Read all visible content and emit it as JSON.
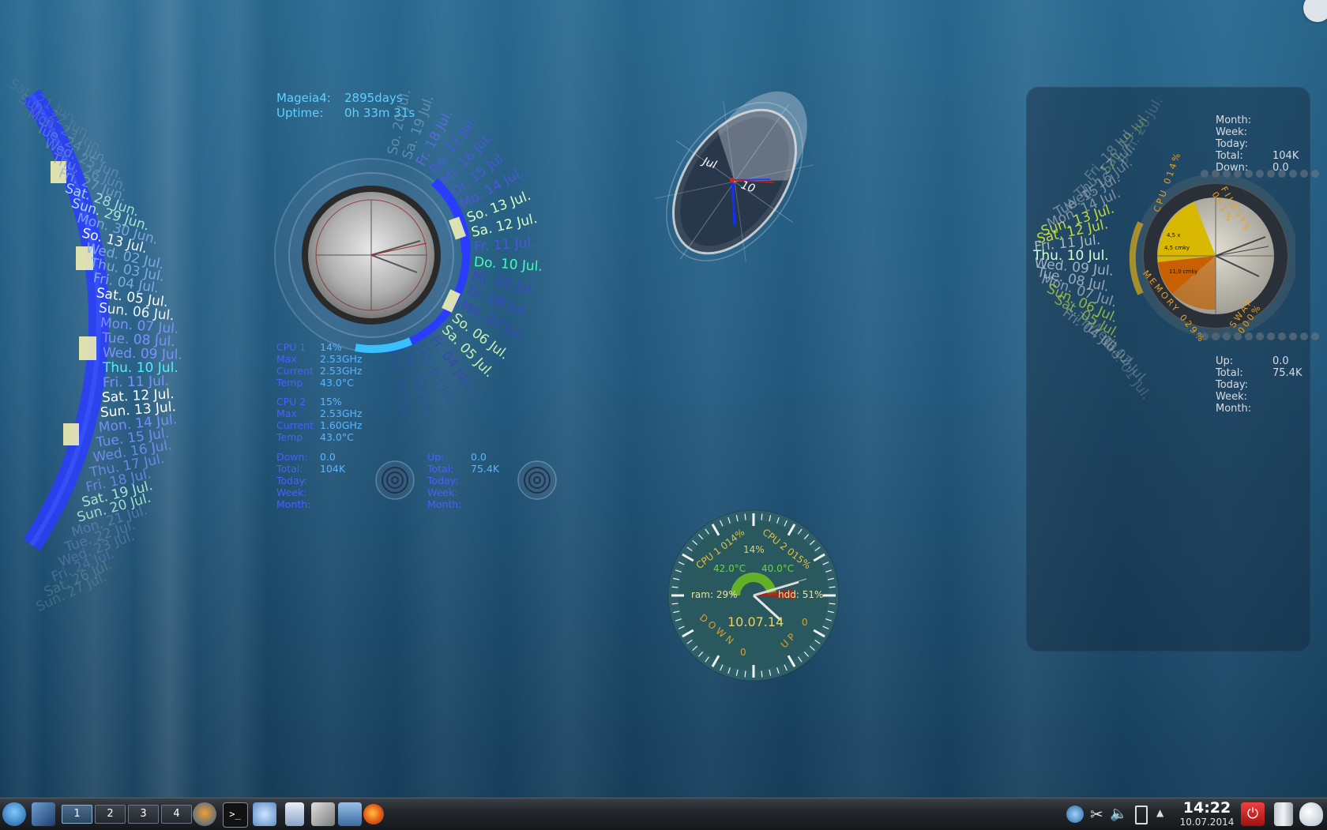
{
  "left_calendar": {
    "days": [
      {
        "label": "Sat. 21 Jun.",
        "color": "#6b86a8",
        "opacity": 0.35
      },
      {
        "label": "Sun. 22 Jun.",
        "color": "#6b86a8",
        "opacity": 0.45
      },
      {
        "label": "Mon. 23 Jun.",
        "color": "#6b86a8",
        "opacity": 0.5
      },
      {
        "label": "Tue. 24 Jun.",
        "color": "#7a98bd",
        "opacity": 0.55
      },
      {
        "label": "Wed. 25 Jun.",
        "color": "#7a98bd",
        "opacity": 0.6
      },
      {
        "label": "Thu. 26 Jun.",
        "color": "#7a98bd",
        "opacity": 0.65
      },
      {
        "label": "Fri. 27 Jun.",
        "color": "#8aa8d0",
        "opacity": 0.7
      },
      {
        "label": "Sat. 28 Jun.",
        "color": "#b8f0e0",
        "opacity": 0.85
      },
      {
        "label": "Sun. 29 Jun.",
        "color": "#b8f0e0",
        "opacity": 0.9
      },
      {
        "label": "Mon. 30 Jun.",
        "color": "#8ab0e8",
        "opacity": 0.85
      },
      {
        "label": "So. 13 Jul.",
        "color": "#ffffff",
        "opacity": 0.95
      },
      {
        "label": "Wed. 02 Jul.",
        "color": "#8ab0f0",
        "opacity": 0.9
      },
      {
        "label": "Thu. 03 Jul.",
        "color": "#8ab0f0",
        "opacity": 0.9
      },
      {
        "label": "Fri. 04 Jul.",
        "color": "#8ab0f0",
        "opacity": 0.9
      },
      {
        "label": "Sat. 05 Jul.",
        "color": "#ffffff",
        "opacity": 1
      },
      {
        "label": "Sun. 06 Jul.",
        "color": "#e8f4ff",
        "opacity": 1
      },
      {
        "label": "Mon. 07 Jul.",
        "color": "#7d90ff",
        "opacity": 1
      },
      {
        "label": "Tue. 08 Jul.",
        "color": "#7d90ff",
        "opacity": 1
      },
      {
        "label": "Wed. 09 Jul.",
        "color": "#7d90ff",
        "opacity": 1
      },
      {
        "label": "Thu. 10 Jul.",
        "color": "#4cf0ff",
        "opacity": 1
      },
      {
        "label": "Fri. 11 Jul.",
        "color": "#7d90ff",
        "opacity": 1
      },
      {
        "label": "Sat. 12 Jul.",
        "color": "#ffffff",
        "opacity": 1
      },
      {
        "label": "Sun. 13 Jul.",
        "color": "#ffffff",
        "opacity": 1
      },
      {
        "label": "Mon. 14 Jul.",
        "color": "#7d90ff",
        "opacity": 0.95
      },
      {
        "label": "Tue. 15 Jul.",
        "color": "#7d90ff",
        "opacity": 0.9
      },
      {
        "label": "Wed. 16 Jul.",
        "color": "#7d90ff",
        "opacity": 0.85
      },
      {
        "label": "Thu. 17 Jul.",
        "color": "#7d90ff",
        "opacity": 0.8
      },
      {
        "label": "Fri. 18 Jul.",
        "color": "#7d90ff",
        "opacity": 0.75
      },
      {
        "label": "Sat. 19 Jul.",
        "color": "#b8f0d8",
        "opacity": 0.9
      },
      {
        "label": "Sun. 20 Jul.",
        "color": "#b8f0d8",
        "opacity": 0.85
      },
      {
        "label": "Mon. 21 Jul.",
        "color": "#7088c8",
        "opacity": 0.6
      },
      {
        "label": "Tue. 22 Jul.",
        "color": "#7088c8",
        "opacity": 0.55
      },
      {
        "label": "Wed. 23 Jul.",
        "color": "#7088c8",
        "opacity": 0.5
      },
      {
        "label": "Fri. 24 Jul.",
        "color": "#7088c8",
        "opacity": 0.45
      },
      {
        "label": "Sat. 26 Jul.",
        "color": "#7aa0a0",
        "opacity": 0.4
      },
      {
        "label": "Sun. 27 Jul.",
        "color": "#7aa0a0",
        "opacity": 0.35
      }
    ]
  },
  "sysinfo": {
    "distro_label": "Mageia4:",
    "distro_value": "2895days",
    "uptime_label": "Uptime:",
    "uptime_value": "0h 33m 31s"
  },
  "cpu1": {
    "name": "CPU 1",
    "load": "14%",
    "max_label": "Max",
    "max": "2.53GHz",
    "current_label": "Current",
    "current": "2.53GHz",
    "temp_label": "Temp",
    "temp": "43.0°C"
  },
  "cpu2": {
    "name": "CPU 2",
    "load": "15%",
    "max_label": "Max",
    "max": "2.53GHz",
    "current_label": "Current",
    "current": "1.60GHz",
    "temp_label": "Temp",
    "temp": "43.0°C"
  },
  "net_down": {
    "down_label": "Down:",
    "down": "0.0",
    "total_label": "Total:",
    "total": "104K",
    "today_label": "Today:",
    "week_label": "Week:",
    "month_label": "Month:"
  },
  "net_up": {
    "up_label": "Up:",
    "up": "0.0",
    "total_label": "Total:",
    "total": "75.4K",
    "today_label": "Today:",
    "week_label": "Week:",
    "month_label": "Month:"
  },
  "dial_calendar": {
    "days": [
      {
        "label": "So. 20 Jul.",
        "color": "#8ab0c0"
      },
      {
        "label": "Sa. 19 Jul.",
        "color": "#8ab0c0"
      },
      {
        "label": "Fr. 18 Jul.",
        "color": "#5b6ad8"
      },
      {
        "label": "Do. 17 Jul.",
        "color": "#4a58d8"
      },
      {
        "label": "Mi. 16 Jul.",
        "color": "#4a58d8"
      },
      {
        "label": "Di. 15 Jul.",
        "color": "#4a58d8"
      },
      {
        "label": "Mo. 14 Jul.",
        "color": "#4a58d8"
      },
      {
        "label": "So. 13 Jul.",
        "color": "#d8ffc0"
      },
      {
        "label": "Sa. 12 Jul.",
        "color": "#d8ffc0"
      },
      {
        "label": "Fr. 11 Jul.",
        "color": "#4a58d8"
      },
      {
        "label": "Do. 10 Jul.",
        "color": "#40ffb0"
      },
      {
        "label": "Mi. 09 Jul.",
        "color": "#3a48c0"
      },
      {
        "label": "Di. 08 Jul.",
        "color": "#3a48c0"
      },
      {
        "label": "Mo. 07 Jul.",
        "color": "#3a48c0"
      },
      {
        "label": "So. 06 Jul.",
        "color": "#c8f0b0"
      },
      {
        "label": "Sa. 05 Jul.",
        "color": "#c8f0b0"
      },
      {
        "label": "Fr. 04 Jul.",
        "color": "#3a48b0"
      },
      {
        "label": "Do. 03 Jul.",
        "color": "#3a48b0"
      },
      {
        "label": "Mi. 02 Jul.",
        "color": "#3a48b0"
      },
      {
        "label": "Di. 01 Jul.",
        "color": "#3a48b0"
      }
    ]
  },
  "ellipse_clock": {
    "month": "Jul",
    "day": "10"
  },
  "system_gauge": {
    "cpu1_label": "CPU 1 014%",
    "cpu2_label": "CPU 2 015%",
    "cpu_total": "14%",
    "temp1": "42.0°C",
    "temp2": "40.0°C",
    "ram_label": "ram: 29%",
    "hdd_label": "hdd: 51%",
    "date": "10.07.14",
    "down_label": "DOWN",
    "down_value": "0",
    "up_label": "UP",
    "up_value": "0"
  },
  "right_panel": {
    "down_stats": {
      "month_label": "Month:",
      "week_label": "Week:",
      "today_label": "Today:",
      "total_label": "Total:",
      "total": "104K",
      "down_label": "Down:",
      "down": "0.0"
    },
    "up_stats": {
      "up_label": "Up:",
      "up": "0.0",
      "total_label": "Total:",
      "total": "75.4K",
      "today_label": "Today:",
      "week_label": "Week:",
      "month_label": "Month:"
    },
    "ring_labels": {
      "cpu": "CPU 014%",
      "filesys": "FILESYS 051%",
      "memory": "MEMORY 029%",
      "swap": "SWAP 000%"
    },
    "pie_labels": [
      "4,5 x",
      "4,5 cmky",
      "11,0 cmky"
    ],
    "calendar_days": [
      {
        "label": "Sun. 20 Jul.",
        "color": "#8aa0a8",
        "opacity": 0.35
      },
      {
        "label": "Sat. 19 Jul.",
        "color": "#a0c060",
        "opacity": 0.45
      },
      {
        "label": "Fri. 18 Jul.",
        "color": "#a8b4bc",
        "opacity": 0.45
      },
      {
        "label": "Thu. 17 Jul.",
        "color": "#a8b4bc",
        "opacity": 0.5
      },
      {
        "label": "Wed. 16 Jul.",
        "color": "#a8b4bc",
        "opacity": 0.55
      },
      {
        "label": "Tue. 15 Jul.",
        "color": "#a8b4bc",
        "opacity": 0.65
      },
      {
        "label": "Mon. 14 Jul.",
        "color": "#a8b4bc",
        "opacity": 0.7
      },
      {
        "label": "Sun. 13 Jul.",
        "color": "#c8e040",
        "opacity": 0.95
      },
      {
        "label": "Sat. 12 Jul.",
        "color": "#c8e040",
        "opacity": 0.95
      },
      {
        "label": "Fri. 11 Jul.",
        "color": "#b8c4cc",
        "opacity": 0.9
      },
      {
        "label": "Thu. 10 Jul.",
        "color": "#d8ffd8",
        "opacity": 1
      },
      {
        "label": "Wed. 09 Jul.",
        "color": "#b8c4cc",
        "opacity": 0.85
      },
      {
        "label": "Tue. 08 Jul.",
        "color": "#b8c4cc",
        "opacity": 0.8
      },
      {
        "label": "Mon. 07 Jul.",
        "color": "#b8c4cc",
        "opacity": 0.7
      },
      {
        "label": "Sun. 06 Jul.",
        "color": "#b0d040",
        "opacity": 0.8
      },
      {
        "label": "Sat. 05 Jul.",
        "color": "#b0d040",
        "opacity": 0.7
      },
      {
        "label": "Fri. 04 Jul.",
        "color": "#a8b4bc",
        "opacity": 0.55
      },
      {
        "label": "Thu. 03 Jul.",
        "color": "#a8b4bc",
        "opacity": 0.45
      },
      {
        "label": "Wed. 02 Jul.",
        "color": "#a8b4bc",
        "opacity": 0.38
      },
      {
        "label": "Tue. 01 Jul.",
        "color": "#a8b4bc",
        "opacity": 0.3
      }
    ]
  },
  "taskbar": {
    "pager": [
      "1",
      "2",
      "3",
      "4"
    ],
    "active_workspace": "1",
    "clock_time": "14:22",
    "clock_date": "10.07.2014",
    "icons": [
      "kde-menu-icon",
      "show-desktop-icon",
      "browser-icon",
      "terminal-icon",
      "kde-icon",
      "document-icon",
      "tools-icon",
      "network-tool-icon",
      "firefox-icon"
    ],
    "tray_icons": [
      "network-icon",
      "scissors-icon",
      "volume-icon",
      "battery-icon",
      "tray-expand-icon"
    ],
    "right_icons": [
      "power-icon",
      "trash-icon",
      "weather-icon"
    ]
  }
}
